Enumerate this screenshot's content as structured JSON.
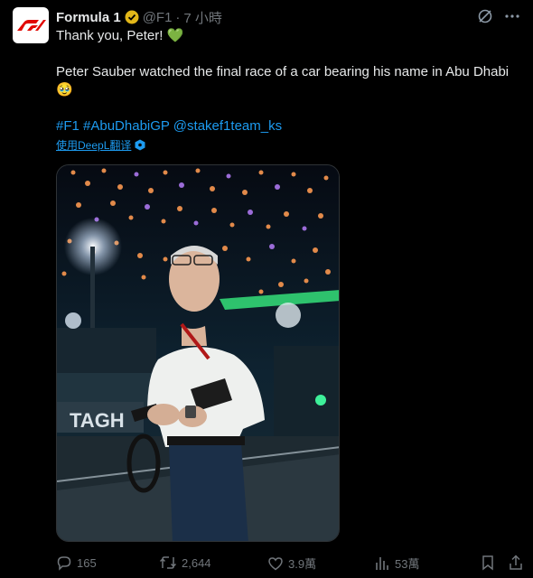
{
  "post": {
    "author_name": "Formula 1",
    "handle": "@F1",
    "separator": "·",
    "time": "7 小時",
    "line1": "Thank you, Peter! 💚",
    "line2": "Peter Sauber watched the final race of a car bearing his name in Abu Dhabi",
    "line2_emoji": "🥹",
    "tags": "#F1 #AbuDhabiGP @stakef1team_ks",
    "translate_label": "使用DeepL翻译",
    "photo_sign": "TAGH"
  },
  "actions": {
    "replies": "165",
    "reposts": "2,644",
    "likes": "3.9萬",
    "views": "53萬"
  },
  "colors": {
    "link": "#1d9bf0",
    "muted": "#71767b",
    "verified": "#e2b719"
  }
}
